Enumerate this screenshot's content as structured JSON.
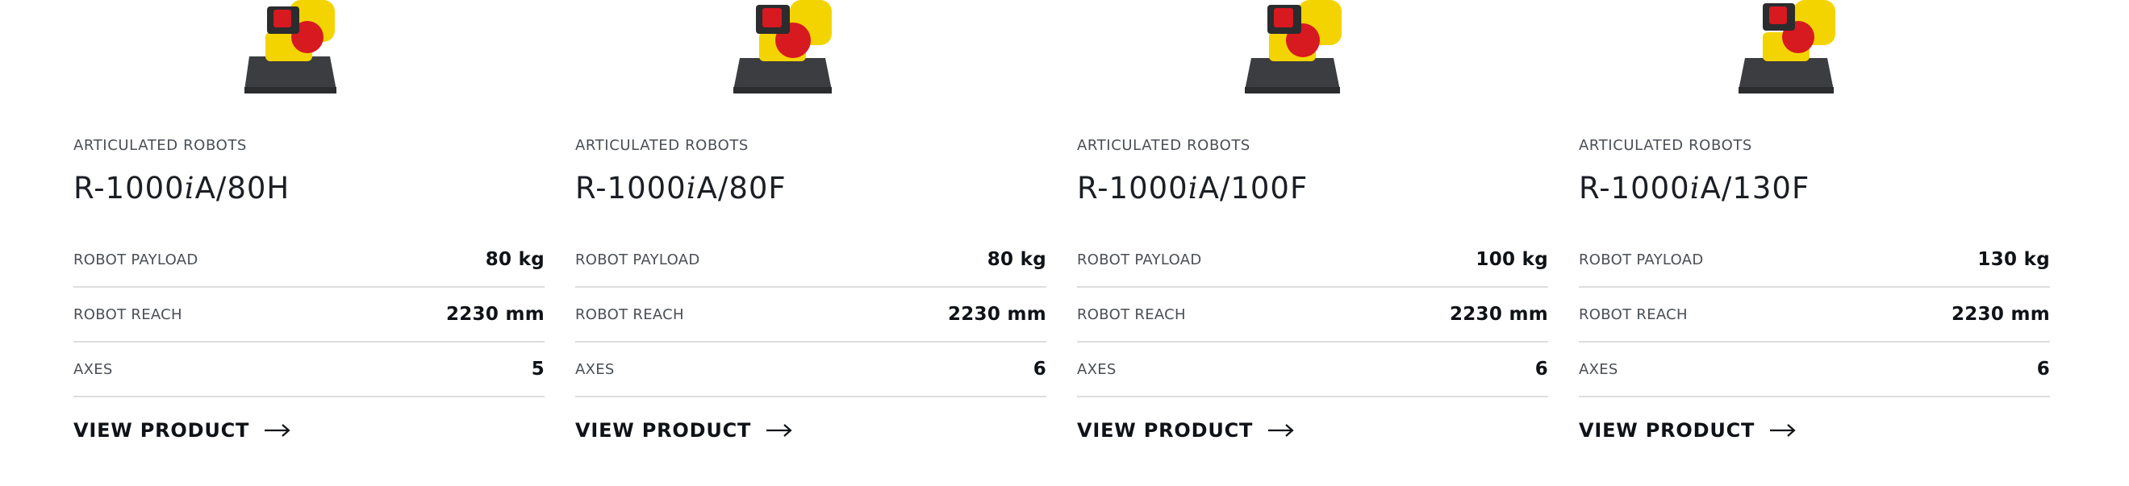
{
  "colors": {
    "robot_yellow": "#f4d400",
    "robot_red": "#d71920",
    "base_gray": "#3b3d40",
    "divider": "#dcdde0"
  },
  "icons": {
    "cta_arrow": "arrow-right-icon"
  },
  "products": [
    {
      "category": "ARTICULATED ROBOTS",
      "model_prefix": "R-1000",
      "model_italic": "i",
      "model_suffix": "A/80H",
      "specs": [
        {
          "label": "ROBOT PAYLOAD",
          "value": "80 kg"
        },
        {
          "label": "ROBOT REACH",
          "value": "2230 mm"
        },
        {
          "label": "AXES",
          "value": "5"
        }
      ],
      "cta": "VIEW PRODUCT"
    },
    {
      "category": "ARTICULATED ROBOTS",
      "model_prefix": "R-1000",
      "model_italic": "i",
      "model_suffix": "A/80F",
      "specs": [
        {
          "label": "ROBOT PAYLOAD",
          "value": "80 kg"
        },
        {
          "label": "ROBOT REACH",
          "value": "2230 mm"
        },
        {
          "label": "AXES",
          "value": "6"
        }
      ],
      "cta": "VIEW PRODUCT"
    },
    {
      "category": "ARTICULATED ROBOTS",
      "model_prefix": "R-1000",
      "model_italic": "i",
      "model_suffix": "A/100F",
      "specs": [
        {
          "label": "ROBOT PAYLOAD",
          "value": "100 kg"
        },
        {
          "label": "ROBOT REACH",
          "value": "2230 mm"
        },
        {
          "label": "AXES",
          "value": "6"
        }
      ],
      "cta": "VIEW PRODUCT"
    },
    {
      "category": "ARTICULATED ROBOTS",
      "model_prefix": "R-1000",
      "model_italic": "i",
      "model_suffix": "A/130F",
      "specs": [
        {
          "label": "ROBOT PAYLOAD",
          "value": "130 kg"
        },
        {
          "label": "ROBOT REACH",
          "value": "2230 mm"
        },
        {
          "label": "AXES",
          "value": "6"
        }
      ],
      "cta": "VIEW PRODUCT"
    }
  ]
}
